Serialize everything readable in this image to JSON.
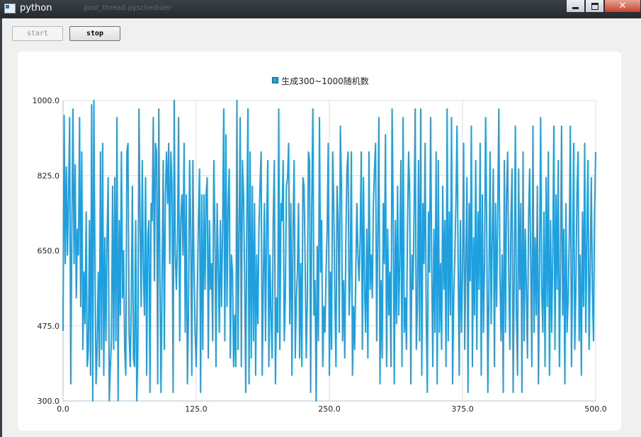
{
  "window": {
    "title": "python",
    "background_tab": "post_thread.pyscheduler"
  },
  "toolbar": {
    "start_label": "start",
    "stop_label": "stop"
  },
  "colors": {
    "series": "#209fdf",
    "grid": "#d8dee4",
    "axis": "#cfd6dc"
  },
  "chart_data": {
    "type": "line",
    "title": "",
    "legend": [
      "生成300~1000随机数"
    ],
    "legend_position": "top",
    "grid": true,
    "xlim": [
      0,
      500
    ],
    "ylim": [
      300,
      1000
    ],
    "xticks": [
      "0.0",
      "125.0",
      "250.0",
      "375.0",
      "500.0"
    ],
    "yticks": [
      "300.0",
      "475.0",
      "650.0",
      "825.0",
      "1000.0"
    ],
    "series": [
      {
        "name": "生成300~1000随机数",
        "values": [
          463,
          965,
          620,
          845,
          640,
          780,
          960,
          340,
          700,
          980,
          620,
          850,
          540,
          700,
          640,
          960,
          520,
          880,
          420,
          600,
          480,
          740,
          380,
          420,
          720,
          360,
          990,
          300,
          1000,
          620,
          340,
          420,
          600,
          380,
          880,
          420,
          900,
          360,
          680,
          440,
          680,
          820,
          300,
          380,
          440,
          800,
          420,
          820,
          440,
          960,
          300,
          720,
          500,
          880,
          540,
          650,
          420,
          360,
          880,
          900,
          460,
          380,
          520,
          800,
          400,
          380,
          720,
          300,
          420,
          980,
          720,
          520,
          860,
          600,
          500,
          820,
          360,
          680,
          720,
          320,
          760,
          720,
          960,
          580,
          900,
          880,
          340,
          980,
          600,
          320,
          580,
          860,
          420,
          780,
          880,
          760,
          900,
          620,
          880,
          800,
          320,
          1000,
          640,
          560,
          680,
          960,
          440,
          720,
          780,
          640,
          900,
          460,
          780,
          340,
          500,
          860,
          700,
          360,
          860,
          600,
          460,
          380,
          540,
          720,
          840,
          320,
          780,
          420,
          780,
          560,
          780,
          820,
          400,
          720,
          560,
          620,
          440,
          860,
          700,
          380,
          760,
          620,
          460,
          720,
          520,
          700,
          980,
          440,
          920,
          520,
          760,
          840,
          400,
          640,
          600,
          380,
          500,
          380,
          1000,
          420,
          700,
          960,
          380,
          860,
          780,
          600,
          320,
          720,
          980,
          340,
          880,
          400,
          800,
          440,
          760,
          360,
          640,
          480,
          700,
          800,
          880,
          360,
          580,
          760,
          440,
          700,
          860,
          380,
          640,
          500,
          400,
          720,
          860,
          340,
          540,
          460,
          980,
          420,
          760,
          720,
          860,
          440,
          540,
          800,
          820,
          900,
          480,
          760,
          360,
          700,
          860,
          400,
          540,
          600,
          760,
          400,
          620,
          380,
          820,
          800,
          620,
          400,
          540,
          880,
          860,
          320,
          760,
          980,
          500,
          580,
          300,
          660,
          440,
          960,
          600,
          720,
          380,
          520,
          460,
          600,
          700,
          900,
          360,
          600,
          420,
          880,
          760,
          540,
          380,
          800,
          720,
          460,
          940,
          800,
          440,
          580,
          400,
          680,
          840,
          880,
          500,
          600,
          880,
          360,
          520,
          420,
          600,
          760,
          640,
          580,
          680,
          880,
          420,
          820,
          560,
          460,
          700,
          400,
          880,
          560,
          640,
          540,
          760,
          840,
          900,
          440,
          680,
          960,
          340,
          580,
          400,
          760,
          620,
          920,
          380,
          700,
          500,
          600,
          380,
          980,
          740,
          340,
          720,
          480,
          800,
          500,
          620,
          860,
          380,
          960,
          460,
          540,
          420,
          700,
          880,
          780,
          340,
          640,
          560,
          740,
          980,
          420,
          520,
          860,
          440,
          980,
          360,
          760,
          620,
          900,
          500,
          320,
          740,
          600,
          960,
          620,
          380,
          700,
          460,
          880,
          340,
          860,
          460,
          620,
          420,
          800,
          560,
          720,
          380,
          980,
          440,
          740,
          500,
          960,
          340,
          540,
          640,
          760,
          940,
          620,
          360,
          720,
          460,
          600,
          900,
          420,
          620,
          820,
          320,
          760,
          580,
          940,
          380,
          680,
          500,
          860,
          420,
          740,
          560,
          900,
          360,
          780,
          460,
          620,
          960,
          700,
          320,
          560,
          880,
          480,
          680,
          840,
          380,
          760,
          520,
          740,
          980,
          600,
          440,
          640,
          320,
          860,
          460,
          780,
          880,
          600,
          420,
          720,
          840,
          320,
          580,
          940,
          500,
          360,
          840,
          560,
          760,
          320,
          880,
          440,
          700,
          560,
          400,
          720,
          840,
          620,
          380,
          940,
          460,
          680,
          500,
          800,
          340,
          620,
          960,
          560,
          460,
          740,
          380,
          820,
          520,
          880,
          360,
          720,
          460,
          640,
          940,
          420,
          780,
          560,
          860,
          380,
          600,
          940,
          500,
          700,
          340,
          760,
          460,
          540,
          680,
          940,
          380,
          600,
          900,
          420,
          560,
          780,
          880,
          440,
          640,
          360,
          740,
          520,
          900,
          460,
          680,
          860,
          420,
          600,
          820,
          560,
          440,
          740,
          880
        ]
      }
    ]
  }
}
